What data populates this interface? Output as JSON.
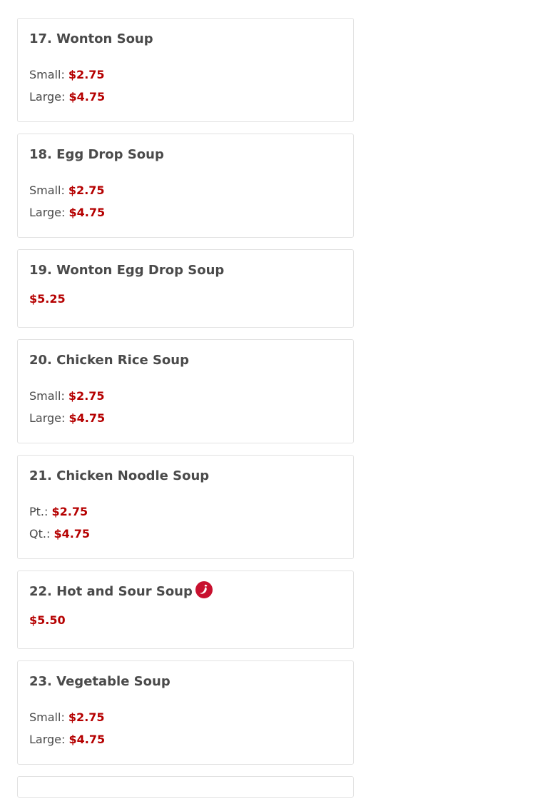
{
  "items": [
    {
      "title": "17. Wonton Soup",
      "prices": [
        {
          "label": "Small:",
          "value": "$2.75"
        },
        {
          "label": "Large:",
          "value": "$4.75"
        }
      ]
    },
    {
      "title": "18. Egg Drop Soup",
      "prices": [
        {
          "label": "Small:",
          "value": "$2.75"
        },
        {
          "label": "Large:",
          "value": "$4.75"
        }
      ]
    },
    {
      "title": "19. Wonton Egg Drop Soup",
      "price": "$5.25"
    },
    {
      "title": "20. Chicken Rice Soup",
      "prices": [
        {
          "label": "Small:",
          "value": "$2.75"
        },
        {
          "label": "Large:",
          "value": "$4.75"
        }
      ]
    },
    {
      "title": "21. Chicken Noodle Soup",
      "prices": [
        {
          "label": "Pt.:",
          "value": "$2.75"
        },
        {
          "label": "Qt.:",
          "value": "$4.75"
        }
      ]
    },
    {
      "title": "22. Hot and Sour Soup",
      "price": "$5.50",
      "icon": "spicy-icon"
    },
    {
      "title": "23. Vegetable Soup",
      "prices": [
        {
          "label": "Small:",
          "value": "$2.75"
        },
        {
          "label": "Large:",
          "value": "$4.75"
        }
      ]
    }
  ],
  "colors": {
    "price": "#b50000",
    "text": "#4a4a4a",
    "border": "#e2e2e2",
    "spicy": "#c8102e"
  }
}
